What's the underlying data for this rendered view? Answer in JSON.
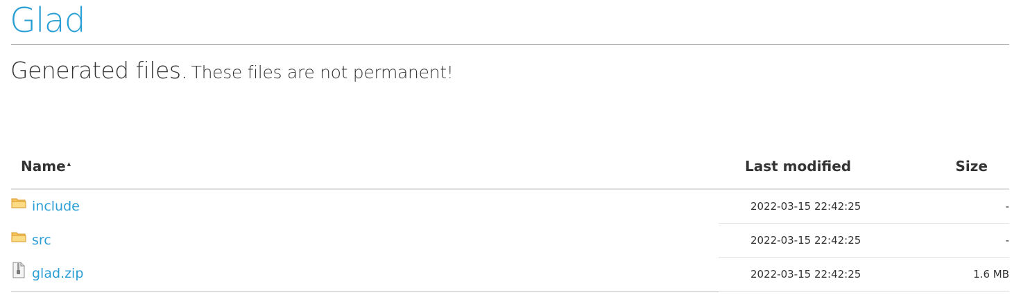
{
  "header": {
    "brand": "Glad",
    "title": "Generated files.",
    "subtitle": "These files are not permanent!"
  },
  "table": {
    "columns": {
      "name": "Name",
      "last_modified": "Last modified",
      "size": "Size",
      "sort_indicator": "▴"
    },
    "rows": [
      {
        "icon": "folder-icon",
        "name": "include",
        "modified": "2022-03-15 22:42:25",
        "size": "-"
      },
      {
        "icon": "folder-icon",
        "name": "src",
        "modified": "2022-03-15 22:42:25",
        "size": "-"
      },
      {
        "icon": "zip-file-icon",
        "name": "glad.zip",
        "modified": "2022-03-15 22:42:25",
        "size": "1.6 MB"
      }
    ]
  },
  "colors": {
    "link": "#2a9fd6",
    "text": "#333333",
    "rule": "#aaaaaa"
  }
}
